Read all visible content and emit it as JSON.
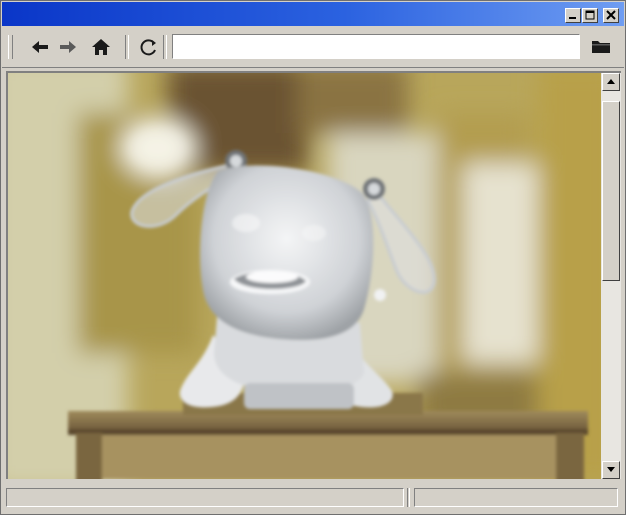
{
  "window": {
    "title": "",
    "controls": {
      "minimize_icon": "minimize-icon",
      "maximize_icon": "maximize-icon",
      "close_icon": "close-icon"
    }
  },
  "toolbar": {
    "back_icon": "arrow-left-icon",
    "forward_icon": "arrow-right-icon",
    "home_icon": "home-icon",
    "reload_icon": "reload-icon",
    "folder_icon": "folder-icon",
    "address": {
      "value": "",
      "placeholder": ""
    }
  },
  "content": {
    "image_subject": "robot-dog-toy",
    "colors": {
      "background": "#b9a55a",
      "table": "#7e6a44",
      "robot": "#e3e4e6"
    }
  },
  "status": {
    "text": "",
    "zone": ""
  },
  "colors": {
    "titlebar_start": "#0a36c8",
    "titlebar_end": "#6f9df2",
    "chrome": "#d4d0c8"
  }
}
